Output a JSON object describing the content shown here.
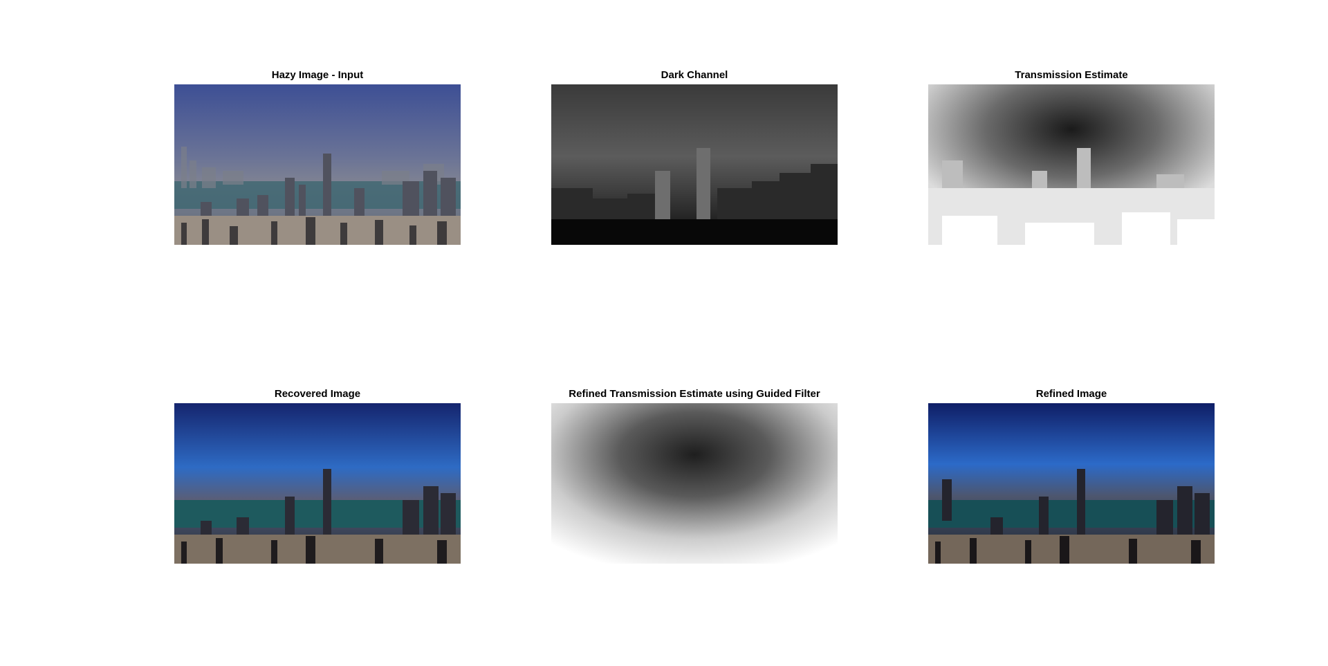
{
  "panels": [
    {
      "title": "Hazy Image - Input"
    },
    {
      "title": "Dark Channel"
    },
    {
      "title": "Transmission Estimate"
    },
    {
      "title": "Recovered Image"
    },
    {
      "title": "Refined Transmission Estimate using Guided Filter"
    },
    {
      "title": "Refined Image"
    }
  ]
}
